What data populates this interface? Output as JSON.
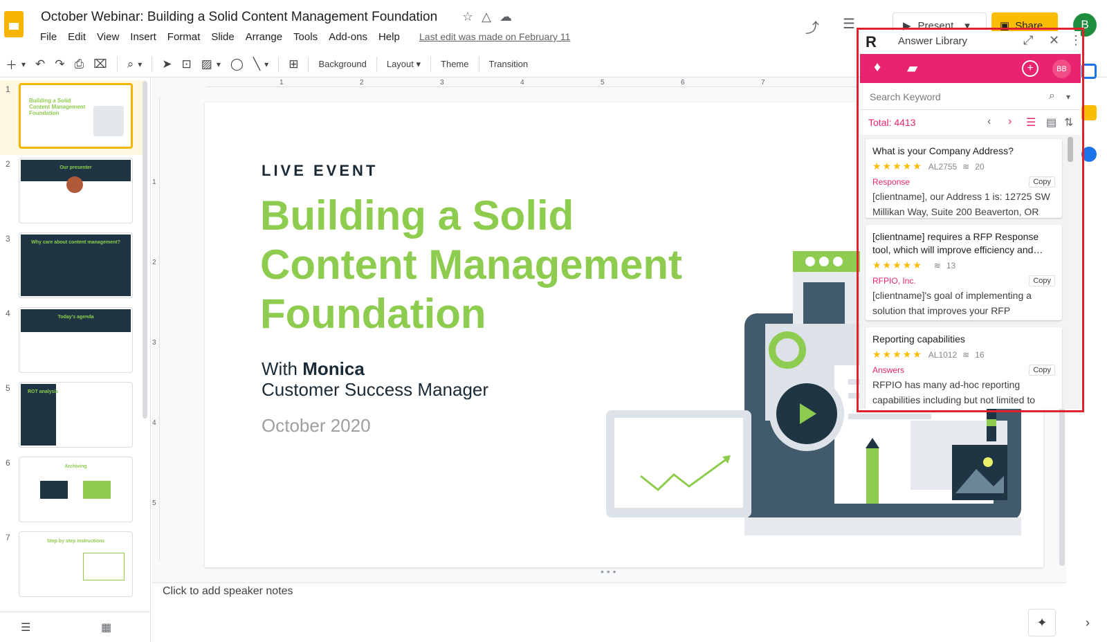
{
  "header": {
    "doc_title": "October Webinar: Building a Solid Content Management Foundation",
    "menu": [
      "File",
      "Edit",
      "View",
      "Insert",
      "Format",
      "Slide",
      "Arrange",
      "Tools",
      "Add-ons",
      "Help"
    ],
    "last_edit": "Last edit was made on February 11",
    "present_label": "Present",
    "share_label": "Share",
    "avatar_letter": "B"
  },
  "toolbar": {
    "background_label": "Background",
    "layout_label": "Layout",
    "theme_label": "Theme",
    "transition_label": "Transition"
  },
  "filmstrip": {
    "slides": [
      {
        "num": "1",
        "caption": "Building a Solid Content Management Foundation"
      },
      {
        "num": "2",
        "caption": "Our presenter"
      },
      {
        "num": "3",
        "caption": "Why care about content management?"
      },
      {
        "num": "4",
        "caption": "Today's agenda"
      },
      {
        "num": "5",
        "caption": "ROT analysis"
      },
      {
        "num": "6",
        "caption": "Archiving"
      },
      {
        "num": "7",
        "caption": "Step by step instructions"
      }
    ]
  },
  "rulers": {
    "h": [
      "1",
      "2",
      "3",
      "4",
      "5",
      "6",
      "7"
    ],
    "v": [
      "1",
      "2",
      "3",
      "4",
      "5"
    ]
  },
  "slide": {
    "eyebrow": "LIVE EVENT",
    "title": "Building a Solid Content Management Foundation",
    "with_prefix": "With",
    "presenter": "Monica",
    "role": "Customer Success Manager",
    "date": "October 2020"
  },
  "notes": {
    "placeholder": "Click to add speaker notes"
  },
  "panel": {
    "title": "Answer Library",
    "user_initials": "BB",
    "search_placeholder": "Search Keyword",
    "total": "Total: 4413",
    "cards": [
      {
        "title": "What is your Company Address?",
        "id": "AL2755",
        "count": "20",
        "source": "Response",
        "copy": "Copy",
        "body": "[clientname], our Address 1 is: 12725 SW Millikan Way, Suite 200 Beaverton, OR"
      },
      {
        "title": "[clientname] requires a RFP Response tool, which will improve efficiency and…",
        "id": "",
        "count": "13",
        "source": "RFPIO, Inc.",
        "copy": "Copy",
        "body": "[clientname]'s goal of implementing a solution that improves your RFP"
      },
      {
        "title": "Reporting capabilities",
        "id": "AL1012",
        "count": "16",
        "source": "Answers",
        "copy": "Copy",
        "body": "RFPIO has many ad-hoc reporting capabilities including but not limited to"
      }
    ]
  },
  "colors": {
    "slides_yellow": "#f4b400",
    "title_green": "#8dcc4e",
    "panel_pink": "#e8236f",
    "highlight_red": "#e0202b"
  }
}
